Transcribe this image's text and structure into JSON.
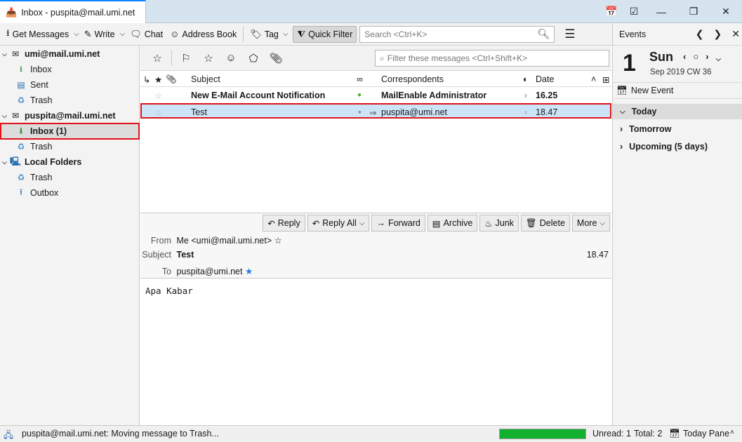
{
  "window": {
    "tab_title": "Inbox - puspita@mail.umi.net",
    "controls": [
      "calendar-icon",
      "tasks-icon",
      "minimize-icon",
      "restore-icon",
      "close-icon"
    ]
  },
  "toolbar": {
    "get_messages": "Get Messages",
    "write": "Write",
    "chat": "Chat",
    "address_book": "Address Book",
    "tag": "Tag",
    "quick_filter": "Quick Filter",
    "search_placeholder": "Search <Ctrl+K>"
  },
  "folders": {
    "accounts": [
      {
        "name": "umi@mail.umi.net",
        "folders": [
          "Inbox",
          "Sent",
          "Trash"
        ]
      },
      {
        "name": "puspita@mail.umi.net",
        "folders": [
          "Inbox (1)",
          "Trash"
        ]
      },
      {
        "name": "Local Folders",
        "folders": [
          "Trash",
          "Outbox"
        ]
      }
    ]
  },
  "quick_filter_bar": {
    "filter_placeholder": "Filter these messages <Ctrl+Shift+K>"
  },
  "thread": {
    "columns": {
      "subject": "Subject",
      "correspondents": "Correspondents",
      "date": "Date"
    },
    "messages": [
      {
        "subject": "New E-Mail Account Notification",
        "correspondent": "MailEnable Administrator",
        "date": "16.25",
        "unread": true
      },
      {
        "subject": "Test",
        "correspondent": "puspita@umi.net",
        "date": "18.47",
        "unread": false,
        "selected": true
      }
    ]
  },
  "message": {
    "actions": {
      "reply": "Reply",
      "reply_all": "Reply All",
      "forward": "Forward",
      "archive": "Archive",
      "junk": "Junk",
      "delete": "Delete",
      "more": "More"
    },
    "from_label": "From",
    "from": "Me <umi@mail.umi.net>",
    "subject_label": "Subject",
    "subject": "Test",
    "to_label": "To",
    "to": "puspita@umi.net",
    "time": "18.47",
    "body": "Apa Kabar"
  },
  "today_pane": {
    "title": "Events",
    "day_number": "1",
    "day_name": "Sun",
    "sub": "Sep 2019  CW 36",
    "new_event": "New Event",
    "agenda": [
      "Today",
      "Tomorrow",
      "Upcoming (5 days)"
    ]
  },
  "status": {
    "text": "puspita@mail.umi.net: Moving message to Trash...",
    "progress_percent": 100,
    "unread": "Unread: 1",
    "total": "Total: 2",
    "today_pane": "Today Pane"
  },
  "colors": {
    "accent": "#0a84ff",
    "selection": "#cce4f7",
    "highlight_box": "#e0121a",
    "progress": "#11b02f"
  }
}
